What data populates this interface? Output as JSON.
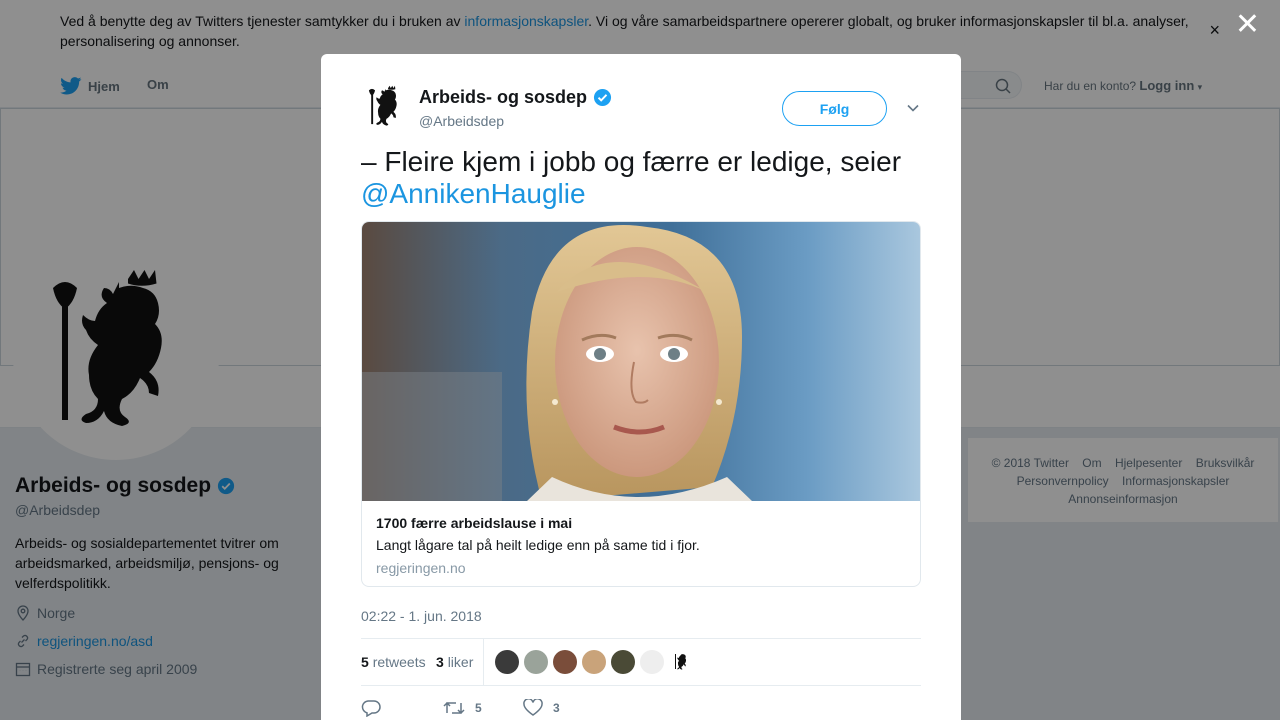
{
  "cookie": {
    "text_before": "Ved å benytte deg av Twitters tjenester samtykker du i bruken av ",
    "link": "informasjonskapsler",
    "text_after": ". Vi og våre samarbeidspartnere opererer globalt, og bruker informasjonskapsler til bl.a. analyser, personalisering og annonser.",
    "close": "×"
  },
  "nav": {
    "home": "Hjem",
    "about": "Om",
    "login_prompt": "Har du en konto?",
    "login": "Logg inn"
  },
  "profile": {
    "name": "Arbeids- og sosdep",
    "handle": "@Arbeidsdep",
    "bio": "Arbeids- og sosialdepartementet tvitrer om arbeidsmarked, arbeidsmiljø, pensjons- og velferdspolitikk.",
    "location": "Norge",
    "website": "regjeringen.no/asd",
    "joined": "Registrerte seg april 2009"
  },
  "footer": {
    "links": [
      "© 2018 Twitter",
      "Om",
      "Hjelpesenter",
      "Bruksvilkår",
      "Personvernpolicy",
      "Informasjonskapsler",
      "Annonseinformasjon"
    ]
  },
  "overlay_close": "✕",
  "tweet": {
    "author_name": "Arbeids- og sosdep",
    "author_handle": "@Arbeidsdep",
    "follow_label": "Følg",
    "text": "– Fleire kjem i jobb og færre er ledige, seier ",
    "mention": "@AnnikenHauglie",
    "card_title": "1700 færre arbeidslause i mai",
    "card_description": "Langt lågare tal på heilt ledige enn på same tid i fjor.",
    "card_domain": "regjeringen.no",
    "timestamp": "02:22 - 1. jun. 2018",
    "retweets_count": "5",
    "retweets_label": "retweets",
    "likes_count": "3",
    "likes_label": "liker",
    "action_retweets": "5",
    "action_likes": "3"
  },
  "colors": {
    "accent": "#1da1f2",
    "link": "#1b95e0",
    "verified": "#1da1f2"
  }
}
